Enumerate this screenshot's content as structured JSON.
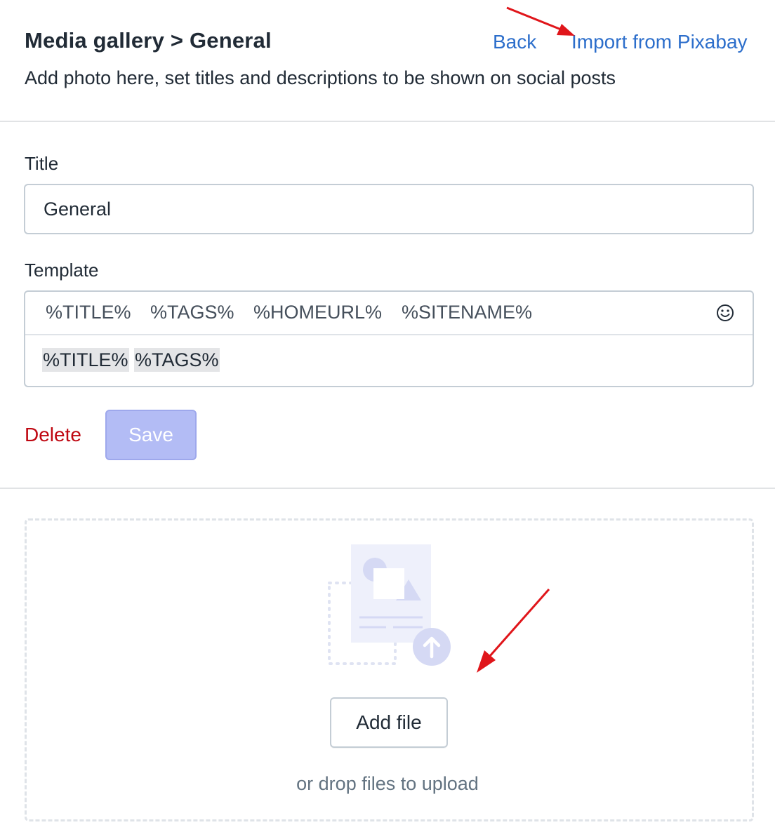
{
  "header": {
    "title": "Media gallery > General",
    "back_label": "Back",
    "import_label": "Import from Pixabay",
    "subtitle": "Add photo here, set titles and descriptions to be shown on social posts"
  },
  "form": {
    "title_label": "Title",
    "title_value": "General",
    "template_label": "Template",
    "template_tags": [
      "%TITLE%",
      "%TAGS%",
      "%HOMEURL%",
      "%SITENAME%"
    ],
    "template_tokens": [
      "%TITLE%",
      "%TAGS%"
    ],
    "emoji_icon": "smiley-icon",
    "delete_label": "Delete",
    "save_label": "Save"
  },
  "upload": {
    "button_label": "Add file",
    "hint": "or drop files to upload",
    "icon": "upload-image-illustration"
  },
  "colors": {
    "link": "#2c6ecb",
    "danger": "#bf0711",
    "primary_disabled": "#b3bcf5",
    "annotation_arrow": "#e0151a"
  }
}
